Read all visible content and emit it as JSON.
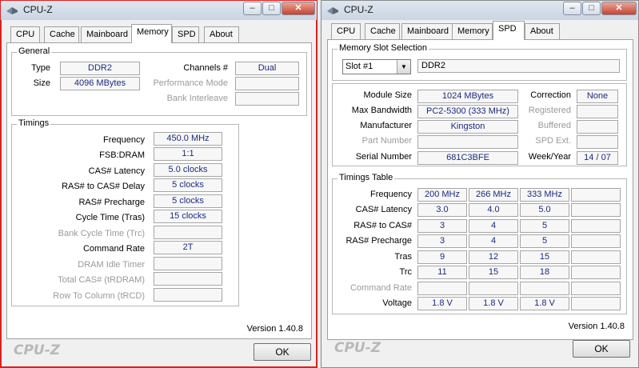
{
  "left": {
    "title": "CPU-Z",
    "tabs": [
      "CPU",
      "Cache",
      "Mainboard",
      "Memory",
      "SPD",
      "About"
    ],
    "general": {
      "label": "General",
      "type_label": "Type",
      "type_value": "DDR2",
      "size_label": "Size",
      "size_value": "4096 MBytes",
      "channels_label": "Channels #",
      "channels_value": "Dual",
      "perf_label": "Performance Mode",
      "perf_value": "",
      "bank_label": "Bank Interleave",
      "bank_value": ""
    },
    "timings": {
      "label": "Timings",
      "rows": [
        {
          "label": "Frequency",
          "value": "450.0 MHz",
          "enabled": true
        },
        {
          "label": "FSB:DRAM",
          "value": "1:1",
          "enabled": true
        },
        {
          "label": "CAS# Latency",
          "value": "5.0 clocks",
          "enabled": true
        },
        {
          "label": "RAS# to CAS# Delay",
          "value": "5 clocks",
          "enabled": true
        },
        {
          "label": "RAS# Precharge",
          "value": "5 clocks",
          "enabled": true
        },
        {
          "label": "Cycle Time (Tras)",
          "value": "15 clocks",
          "enabled": true
        },
        {
          "label": "Bank Cycle Time (Trc)",
          "value": "",
          "enabled": false
        },
        {
          "label": "Command Rate",
          "value": "2T",
          "enabled": true
        },
        {
          "label": "DRAM Idle Timer",
          "value": "",
          "enabled": false
        },
        {
          "label": "Total CAS# (tRDRAM)",
          "value": "",
          "enabled": false
        },
        {
          "label": "Row To Column (tRCD)",
          "value": "",
          "enabled": false
        }
      ]
    },
    "version": "Version 1.40.8",
    "logo": "CPU-Z",
    "ok": "OK"
  },
  "right": {
    "title": "CPU-Z",
    "tabs": [
      "CPU",
      "Cache",
      "Mainboard",
      "Memory",
      "SPD",
      "About"
    ],
    "slot": {
      "label": "Memory Slot Selection",
      "selected": "Slot #1",
      "type_value": "DDR2"
    },
    "module": {
      "module_size_label": "Module Size",
      "module_size_value": "1024 MBytes",
      "max_bw_label": "Max Bandwidth",
      "max_bw_value": "PC2-5300 (333 MHz)",
      "manufacturer_label": "Manufacturer",
      "manufacturer_value": "Kingston",
      "part_label": "Part Number",
      "part_value": "",
      "serial_label": "Serial Number",
      "serial_value": "681C3BFE",
      "correction_label": "Correction",
      "correction_value": "None",
      "registered_label": "Registered",
      "registered_value": "",
      "buffered_label": "Buffered",
      "buffered_value": "",
      "spdext_label": "SPD Ext.",
      "spdext_value": "",
      "week_label": "Week/Year",
      "week_value": "14 / 07"
    },
    "timings_table": {
      "label": "Timings Table",
      "rows": [
        {
          "label": "Frequency",
          "values": [
            "200 MHz",
            "266 MHz",
            "333 MHz",
            ""
          ],
          "enabled": true
        },
        {
          "label": "CAS# Latency",
          "values": [
            "3.0",
            "4.0",
            "5.0",
            ""
          ],
          "enabled": true
        },
        {
          "label": "RAS# to CAS#",
          "values": [
            "3",
            "4",
            "5",
            ""
          ],
          "enabled": true
        },
        {
          "label": "RAS# Precharge",
          "values": [
            "3",
            "4",
            "5",
            ""
          ],
          "enabled": true
        },
        {
          "label": "Tras",
          "values": [
            "9",
            "12",
            "15",
            ""
          ],
          "enabled": true
        },
        {
          "label": "Trc",
          "values": [
            "11",
            "15",
            "18",
            ""
          ],
          "enabled": true
        },
        {
          "label": "Command Rate",
          "values": [
            "",
            "",
            "",
            ""
          ],
          "enabled": false
        },
        {
          "label": "Voltage",
          "values": [
            "1.8 V",
            "1.8 V",
            "1.8 V",
            ""
          ],
          "enabled": true
        }
      ]
    },
    "version": "Version 1.40.8",
    "logo": "CPU-Z",
    "ok": "OK"
  },
  "colors": {
    "value_text": "#1a2a80",
    "disabled_text": "#9a9a9a",
    "close_button": "#c6432e",
    "focus_outline": "#e02020"
  }
}
